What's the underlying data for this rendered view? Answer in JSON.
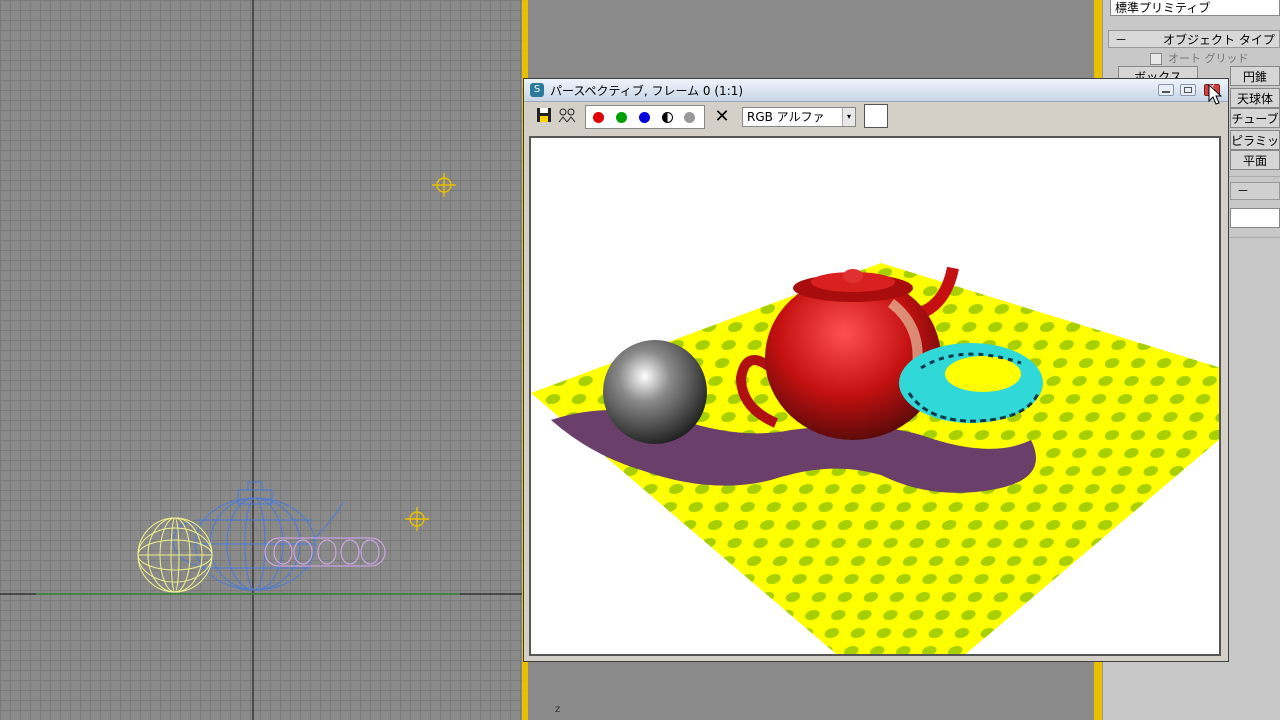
{
  "frame_window": {
    "title": "パースペクティブ, フレーム 0 (1:1)",
    "app_icon_glyph": "S",
    "channel_select": "RGB アルファ",
    "channel_colors": {
      "red": "#e00000",
      "green": "#00a000",
      "blue": "#0000e0"
    }
  },
  "command_panel": {
    "category": "標準プリミティブ",
    "rollout_toggle": "－",
    "rollout_title": "オブジェクト タイプ",
    "autogrid_label": "オート グリッド",
    "buttons": [
      "ボックス",
      "円錐",
      "天球体",
      "チューブ",
      "ピラミッド",
      "平面"
    ],
    "rollout2_toggle": "－"
  },
  "right_viewport": {
    "axis_label": "z"
  },
  "colors": {
    "viewport_bg": "#8a8a8a",
    "viewport_border": "#e8c000",
    "plane_yellow": "#ffff00",
    "dots": "#a8d000",
    "shadow": "#6a3f6a",
    "teapot": "#cc1010",
    "torus": "#30d8d8"
  }
}
